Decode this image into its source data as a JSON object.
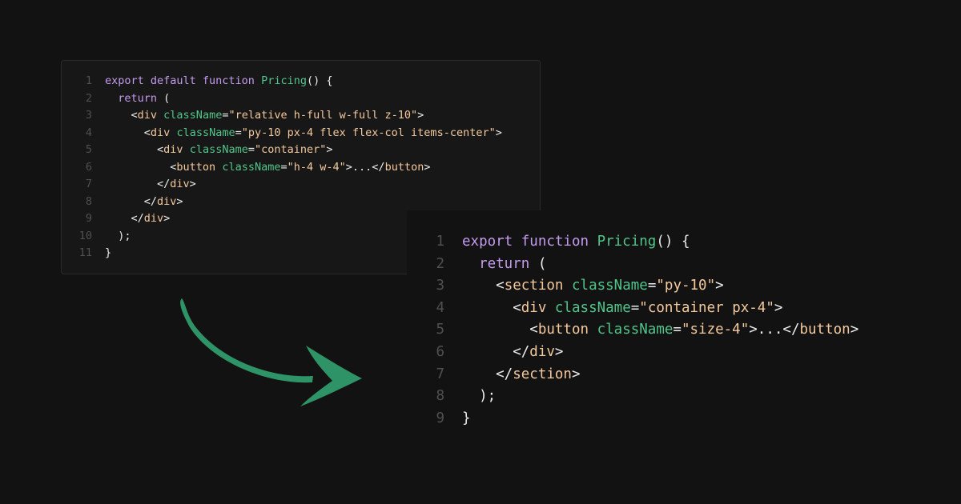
{
  "colors": {
    "background": "#121212",
    "panel": "#171717",
    "panel_border": "#2a2a2a",
    "line_number": "#505050",
    "keyword": "#c49bef",
    "function_name": "#52c58a",
    "attribute": "#52c58a",
    "string": "#f4c99e",
    "tag": "#f4c99e",
    "punctuation": "#ececec",
    "arrow": "#2e9467"
  },
  "icons": {
    "arrow": "curved-arrow-icon"
  },
  "before": {
    "lines": [
      {
        "num": "1",
        "tokens": [
          {
            "t": "export default function ",
            "c": "kw"
          },
          {
            "t": "Pricing",
            "c": "fn"
          },
          {
            "t": "() {",
            "c": "p"
          }
        ]
      },
      {
        "num": "2",
        "tokens": [
          {
            "t": "  ",
            "c": "p"
          },
          {
            "t": "return",
            "c": "kw"
          },
          {
            "t": " (",
            "c": "p"
          }
        ]
      },
      {
        "num": "3",
        "tokens": [
          {
            "t": "    <",
            "c": "p"
          },
          {
            "t": "div",
            "c": "tag"
          },
          {
            "t": " ",
            "c": "p"
          },
          {
            "t": "className",
            "c": "attr"
          },
          {
            "t": "=",
            "c": "p"
          },
          {
            "t": "\"relative h-full w-full z-10\"",
            "c": "str"
          },
          {
            "t": ">",
            "c": "p"
          }
        ]
      },
      {
        "num": "4",
        "tokens": [
          {
            "t": "      <",
            "c": "p"
          },
          {
            "t": "div",
            "c": "tag"
          },
          {
            "t": " ",
            "c": "p"
          },
          {
            "t": "className",
            "c": "attr"
          },
          {
            "t": "=",
            "c": "p"
          },
          {
            "t": "\"py-10 px-4 flex flex-col items-center\"",
            "c": "str"
          },
          {
            "t": ">",
            "c": "p"
          }
        ]
      },
      {
        "num": "5",
        "tokens": [
          {
            "t": "        <",
            "c": "p"
          },
          {
            "t": "div",
            "c": "tag"
          },
          {
            "t": " ",
            "c": "p"
          },
          {
            "t": "className",
            "c": "attr"
          },
          {
            "t": "=",
            "c": "p"
          },
          {
            "t": "\"container\"",
            "c": "str"
          },
          {
            "t": ">",
            "c": "p"
          }
        ]
      },
      {
        "num": "6",
        "tokens": [
          {
            "t": "          <",
            "c": "p"
          },
          {
            "t": "button",
            "c": "tag"
          },
          {
            "t": " ",
            "c": "p"
          },
          {
            "t": "className",
            "c": "attr"
          },
          {
            "t": "=",
            "c": "p"
          },
          {
            "t": "\"h-4 w-4\"",
            "c": "str"
          },
          {
            "t": ">...</",
            "c": "p"
          },
          {
            "t": "button",
            "c": "tag"
          },
          {
            "t": ">",
            "c": "p"
          }
        ]
      },
      {
        "num": "7",
        "tokens": [
          {
            "t": "        </",
            "c": "p"
          },
          {
            "t": "div",
            "c": "tag"
          },
          {
            "t": ">",
            "c": "p"
          }
        ]
      },
      {
        "num": "8",
        "tokens": [
          {
            "t": "      </",
            "c": "p"
          },
          {
            "t": "div",
            "c": "tag"
          },
          {
            "t": ">",
            "c": "p"
          }
        ]
      },
      {
        "num": "9",
        "tokens": [
          {
            "t": "    </",
            "c": "p"
          },
          {
            "t": "div",
            "c": "tag"
          },
          {
            "t": ">",
            "c": "p"
          }
        ]
      },
      {
        "num": "10",
        "tokens": [
          {
            "t": "  );",
            "c": "p"
          }
        ]
      },
      {
        "num": "11",
        "tokens": [
          {
            "t": "}",
            "c": "p"
          }
        ]
      }
    ]
  },
  "after": {
    "lines": [
      {
        "num": "1",
        "tokens": [
          {
            "t": "export function ",
            "c": "kw"
          },
          {
            "t": "Pricing",
            "c": "fn"
          },
          {
            "t": "() {",
            "c": "p"
          }
        ]
      },
      {
        "num": "2",
        "tokens": [
          {
            "t": "  ",
            "c": "p"
          },
          {
            "t": "return",
            "c": "kw"
          },
          {
            "t": " (",
            "c": "p"
          }
        ]
      },
      {
        "num": "3",
        "tokens": [
          {
            "t": "    <",
            "c": "p"
          },
          {
            "t": "section",
            "c": "tag"
          },
          {
            "t": " ",
            "c": "p"
          },
          {
            "t": "className",
            "c": "attr"
          },
          {
            "t": "=",
            "c": "p"
          },
          {
            "t": "\"py-10\"",
            "c": "str"
          },
          {
            "t": ">",
            "c": "p"
          }
        ]
      },
      {
        "num": "4",
        "tokens": [
          {
            "t": "      <",
            "c": "p"
          },
          {
            "t": "div",
            "c": "tag"
          },
          {
            "t": " ",
            "c": "p"
          },
          {
            "t": "className",
            "c": "attr"
          },
          {
            "t": "=",
            "c": "p"
          },
          {
            "t": "\"container px-4\"",
            "c": "str"
          },
          {
            "t": ">",
            "c": "p"
          }
        ]
      },
      {
        "num": "5",
        "tokens": [
          {
            "t": "        <",
            "c": "p"
          },
          {
            "t": "button",
            "c": "tag"
          },
          {
            "t": " ",
            "c": "p"
          },
          {
            "t": "className",
            "c": "attr"
          },
          {
            "t": "=",
            "c": "p"
          },
          {
            "t": "\"size-4\"",
            "c": "str"
          },
          {
            "t": ">...</",
            "c": "p"
          },
          {
            "t": "button",
            "c": "tag"
          },
          {
            "t": ">",
            "c": "p"
          }
        ]
      },
      {
        "num": "6",
        "tokens": [
          {
            "t": "      </",
            "c": "p"
          },
          {
            "t": "div",
            "c": "tag"
          },
          {
            "t": ">",
            "c": "p"
          }
        ]
      },
      {
        "num": "7",
        "tokens": [
          {
            "t": "    </",
            "c": "p"
          },
          {
            "t": "section",
            "c": "tag"
          },
          {
            "t": ">",
            "c": "p"
          }
        ]
      },
      {
        "num": "8",
        "tokens": [
          {
            "t": "  );",
            "c": "p"
          }
        ]
      },
      {
        "num": "9",
        "tokens": [
          {
            "t": "}",
            "c": "p"
          }
        ]
      }
    ]
  }
}
